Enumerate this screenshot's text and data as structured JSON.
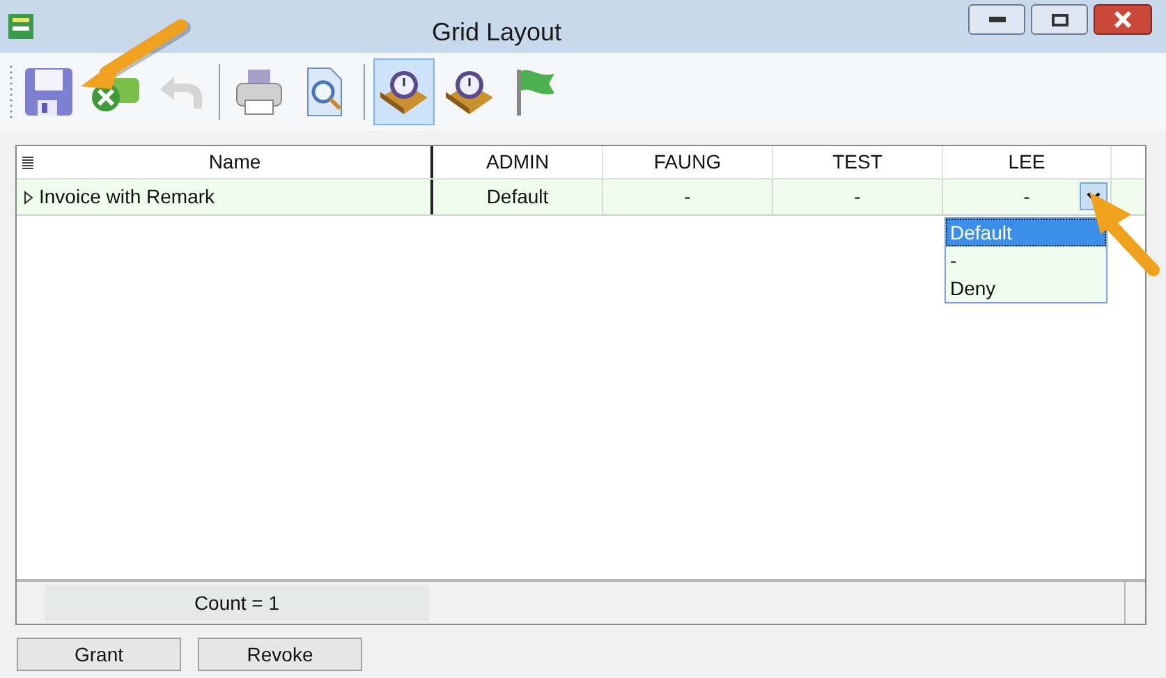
{
  "window": {
    "title": "Grid Layout"
  },
  "toolbar": [
    {
      "kind": "save",
      "disabled": false,
      "selected": false
    },
    {
      "kind": "cancel",
      "disabled": false,
      "selected": false
    },
    {
      "kind": "undo",
      "disabled": true,
      "selected": false
    },
    {
      "kind": "separator"
    },
    {
      "kind": "print",
      "disabled": false,
      "selected": false
    },
    {
      "kind": "preview",
      "disabled": false,
      "selected": false
    },
    {
      "kind": "separator"
    },
    {
      "kind": "clock-book",
      "disabled": false,
      "selected": true
    },
    {
      "kind": "clock-note",
      "disabled": false,
      "selected": false
    },
    {
      "kind": "flag",
      "disabled": false,
      "selected": false
    }
  ],
  "table": {
    "columns": [
      "Name",
      "ADMIN",
      "FAUNG",
      "TEST",
      "LEE"
    ],
    "rows": [
      {
        "cells": [
          "Invoice with Remark",
          "Default",
          "-",
          "-",
          "-"
        ],
        "selected": true
      }
    ]
  },
  "dropdown": {
    "options": [
      {
        "label": "Default",
        "selected": true
      },
      {
        "label": "-",
        "selected": false
      },
      {
        "label": "Deny",
        "selected": false
      }
    ]
  },
  "footer": {
    "count": "Count = 1"
  },
  "buttons": [
    "Grant",
    "Revoke"
  ]
}
